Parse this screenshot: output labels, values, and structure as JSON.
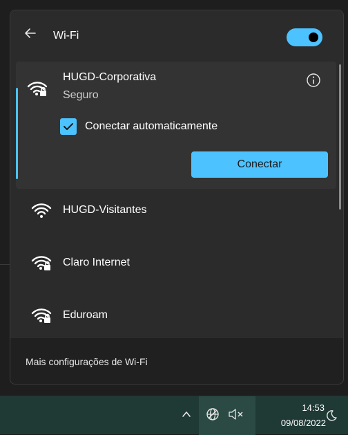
{
  "header": {
    "title": "Wi-Fi",
    "toggle_on": true
  },
  "networks": [
    {
      "name": "HUGD-Corporativa",
      "status": "Seguro",
      "secured": true,
      "expanded": true,
      "auto_connect_label": "Conectar automaticamente",
      "auto_connect_checked": true,
      "connect_label": "Conectar"
    },
    {
      "name": "HUGD-Visitantes",
      "secured": false
    },
    {
      "name": "Claro Internet",
      "secured": true
    },
    {
      "name": "Eduroam",
      "secured": true
    }
  ],
  "footer": {
    "more_settings": "Mais configurações de Wi-Fi"
  },
  "taskbar": {
    "time": "14:53",
    "date": "09/08/2022"
  },
  "colors": {
    "accent": "#4cc2ff",
    "flyout_bg": "#2b2b2b",
    "taskbar_bg": "#1f3a35"
  },
  "icons": [
    "back-arrow-icon",
    "wifi-locked-icon",
    "wifi-icon",
    "info-icon",
    "checkmark-icon",
    "chevron-up-icon",
    "globe-icon",
    "speaker-muted-icon",
    "moon-icon"
  ]
}
